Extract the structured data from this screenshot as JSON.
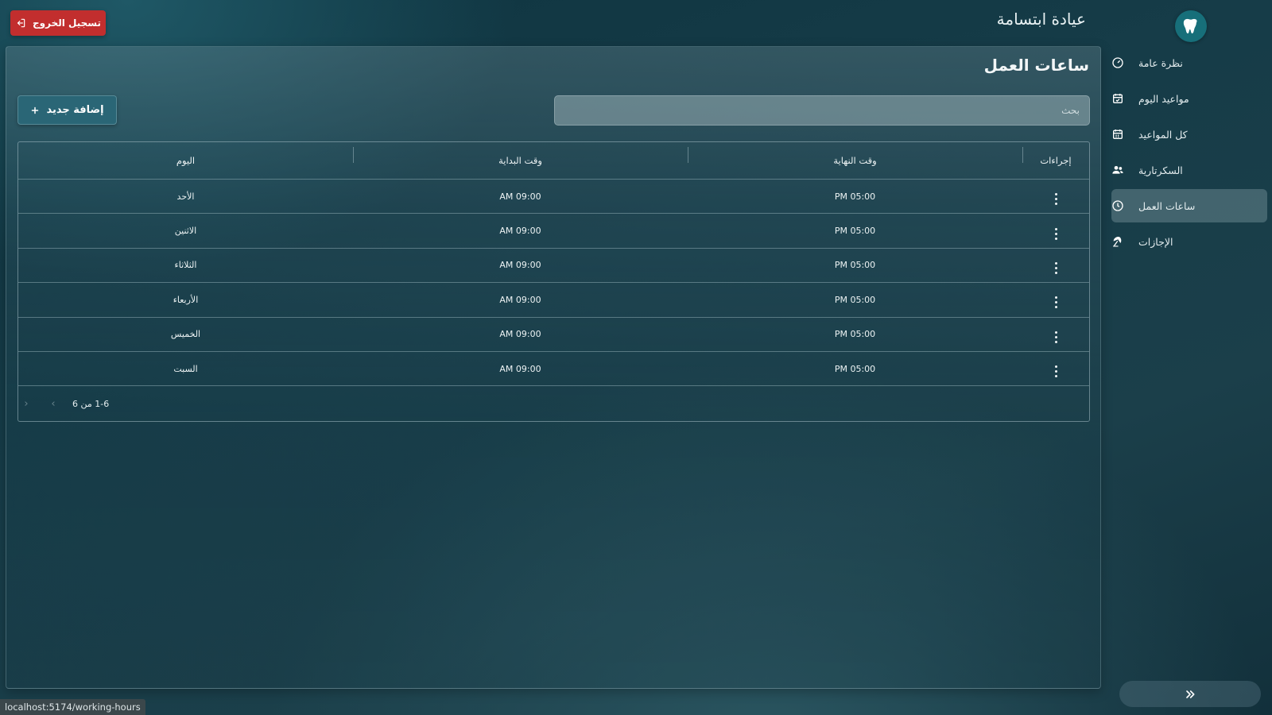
{
  "header": {
    "clinic_name": "عيادة ابتسامة",
    "logout_label": "تسجيل الخروج"
  },
  "sidebar": {
    "items": [
      {
        "label": "نظرة عامة",
        "icon": "gauge-icon",
        "active": false
      },
      {
        "label": "مواعيد اليوم",
        "icon": "calendar-check-icon",
        "active": false
      },
      {
        "label": "كل المواعيد",
        "icon": "calendar-grid-icon",
        "active": false
      },
      {
        "label": "السكرتارية",
        "icon": "users-icon",
        "active": false
      },
      {
        "label": "ساعات العمل",
        "icon": "clock-icon",
        "active": true
      },
      {
        "label": "الإجازات",
        "icon": "beach-umbrella-icon",
        "active": false
      }
    ],
    "collapse_icon": "double-chevron-right-icon"
  },
  "main": {
    "page_title": "ساعات العمل",
    "search_placeholder": "بحث",
    "add_label": "إضافة جديد",
    "table": {
      "columns": {
        "actions": "إجراءات",
        "end_time": "وقت النهاية",
        "start_time": "وقت البداية",
        "day": "اليوم"
      },
      "rows": [
        {
          "day": "الأحد",
          "start": "09:00 AM",
          "end": "05:00 PM"
        },
        {
          "day": "الاثنين",
          "start": "09:00 AM",
          "end": "05:00 PM"
        },
        {
          "day": "الثلاثاء",
          "start": "09:00 AM",
          "end": "05:00 PM"
        },
        {
          "day": "الأربعاء",
          "start": "09:00 AM",
          "end": "05:00 PM"
        },
        {
          "day": "الخميس",
          "start": "09:00 AM",
          "end": "05:00 PM"
        },
        {
          "day": "السبت",
          "start": "09:00 AM",
          "end": "05:00 PM"
        }
      ],
      "pagination": "1-6 من 6"
    }
  },
  "status_bar": {
    "url": "localhost:5174/working-hours"
  },
  "colors": {
    "logout": "#c22e2e",
    "add_button": "#2a6676",
    "logo": "#176f7a"
  }
}
